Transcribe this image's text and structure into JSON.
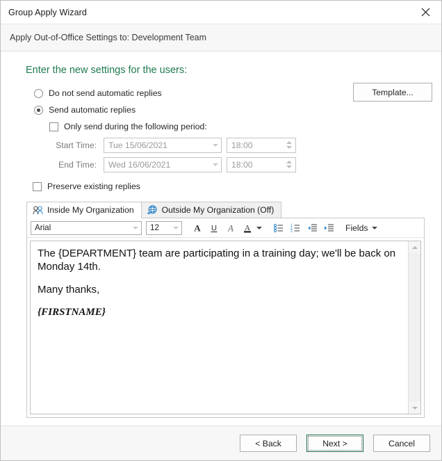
{
  "window": {
    "title": "Group Apply Wizard",
    "close_icon": "close-icon",
    "subheader": "Apply Out-of-Office Settings to: Development Team"
  },
  "main": {
    "page_title": "Enter the new settings for the users:",
    "accent_green": "#1f7a4d",
    "options": {
      "do_not_send_label": "Do not send automatic replies",
      "send_label": "Send automatic replies",
      "only_send_label": "Only send during the following period:",
      "preserve_label": "Preserve existing replies",
      "do_not_send_checked": "false",
      "send_checked": "true",
      "only_send_checked": "false",
      "preserve_checked": "false"
    },
    "schedule": {
      "start_label": "Start Time:",
      "start_date": "Tue 15/06/2021",
      "start_time": "18:00",
      "end_label": "End Time:",
      "end_date": "Wed 16/06/2021",
      "end_time": "18:00"
    },
    "template_button": "Template..."
  },
  "tabs": [
    {
      "label": "Inside My Organization",
      "icon": "person-icon",
      "active": "true"
    },
    {
      "label": "Outside My Organization (Off)",
      "icon": "globe-icon",
      "active": "false"
    }
  ],
  "toolbar": {
    "font_name": "Arial",
    "font_size": "12",
    "bold_icon": "bold-icon",
    "underline_icon": "underline-icon",
    "italic_icon": "italic-icon",
    "font_color_icon": "font-color-icon",
    "font_color_caret_icon": "chevron-down-icon",
    "bullets_icon": "bulleted-list-icon",
    "numbering_icon": "numbered-list-icon",
    "decrease_indent_icon": "decrease-indent-icon",
    "increase_indent_icon": "increase-indent-icon",
    "fields_label": "Fields",
    "accent_blue": "#2b84c8"
  },
  "editor": {
    "paragraph_1": "The {DEPARTMENT} team are participating in a training day; we'll be back on Monday 14th.",
    "paragraph_2": "Many thanks,",
    "signature": "{FIRSTNAME}",
    "scroll_up_icon": "scroll-up-icon",
    "scroll_down_icon": "scroll-down-icon"
  },
  "footer": {
    "back": "< Back",
    "next": "Next >",
    "cancel": "Cancel"
  }
}
